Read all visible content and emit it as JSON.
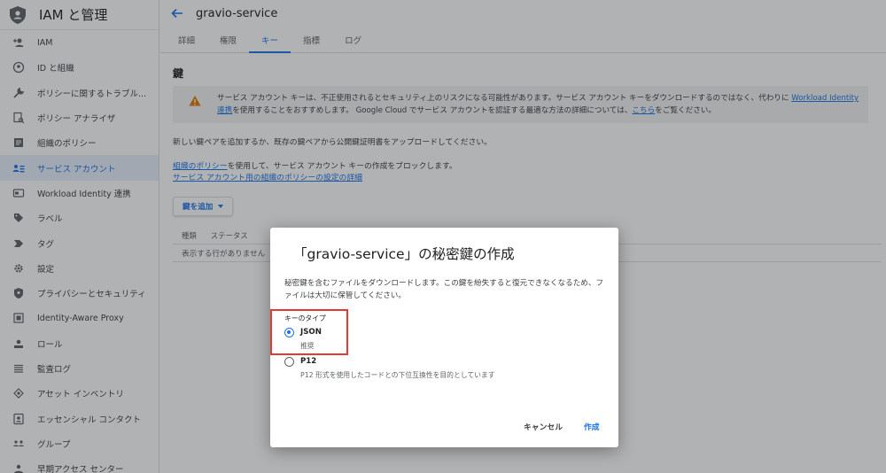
{
  "sidebar": {
    "title": "IAM と管理",
    "items": [
      {
        "label": "IAM",
        "icon": "person-add-icon"
      },
      {
        "label": "ID と組織",
        "icon": "account-circle-icon"
      },
      {
        "label": "ポリシーに関するトラブル...",
        "icon": "wrench-icon"
      },
      {
        "label": "ポリシー アナライザ",
        "icon": "document-search-icon"
      },
      {
        "label": "組織のポリシー",
        "icon": "list-box-icon"
      },
      {
        "label": "サービス アカウント",
        "icon": "service-account-icon"
      },
      {
        "label": "Workload Identity 連携",
        "icon": "id-card-icon"
      },
      {
        "label": "ラベル",
        "icon": "tag-icon"
      },
      {
        "label": "タグ",
        "icon": "chevron-tag-icon"
      },
      {
        "label": "設定",
        "icon": "gear-icon"
      },
      {
        "label": "プライバシーとセキュリティ",
        "icon": "shield-icon"
      },
      {
        "label": "Identity-Aware Proxy",
        "icon": "proxy-icon"
      },
      {
        "label": "ロール",
        "icon": "roles-icon"
      },
      {
        "label": "監査ログ",
        "icon": "lines-icon"
      },
      {
        "label": "アセット インベントリ",
        "icon": "diamond-icon"
      },
      {
        "label": "エッセンシャル コンタクト",
        "icon": "contact-icon"
      },
      {
        "label": "グループ",
        "icon": "group-icon"
      },
      {
        "label": "早期アクセス センター",
        "icon": "early-access-icon"
      }
    ]
  },
  "header": {
    "title": "gravio-service"
  },
  "tabs": [
    {
      "label": "詳細"
    },
    {
      "label": "権限"
    },
    {
      "label": "キー"
    },
    {
      "label": "指標"
    },
    {
      "label": "ログ"
    }
  ],
  "main": {
    "section_title": "鍵",
    "warning_pre": "サービス アカウント キーは、不正使用されるとセキュリティ上のリスクになる可能性があります。サービス アカウント キーをダウンロードするのではなく、代わりに ",
    "warning_link1": "Workload Identity 連携",
    "warning_mid": "を使用することをおすすめします。 Google Cloud でサービス アカウントを認証する最適な方法の詳細については、",
    "warning_link2": "こちら",
    "warning_post": "をご覧ください。",
    "add_info": "新しい鍵ペアを追加するか、既存の鍵ペアから公開鍵証明書をアップロードしてください。",
    "policy_link": "組織のポリシー",
    "policy_text": "を使用して、サービス アカウント キーの作成をブロックします。",
    "policy_detail_link": "サービス アカウント用の組織のポリシーの設定の詳細",
    "add_key_button": "鍵を追加",
    "table_headers": [
      "種類",
      "ステータス"
    ],
    "empty_row": "表示する行がありません"
  },
  "dialog": {
    "title": "「gravio-service」の秘密鍵の作成",
    "description": "秘密鍵を含むファイルをダウンロードします。この鍵を紛失すると復元できなくなるため、ファイルは大切に保管してください。",
    "key_type_label": "キーのタイプ",
    "options": [
      {
        "label": "JSON",
        "sub": "推奨",
        "checked": true
      },
      {
        "label": "P12",
        "sub": "P12 形式を使用したコードとの下位互換性を目的としています",
        "checked": false
      }
    ],
    "cancel_label": "キャンセル",
    "create_label": "作成"
  },
  "colors": {
    "accent": "#1a73e8",
    "highlight_box": "#e53935",
    "warning": "#e37400"
  }
}
